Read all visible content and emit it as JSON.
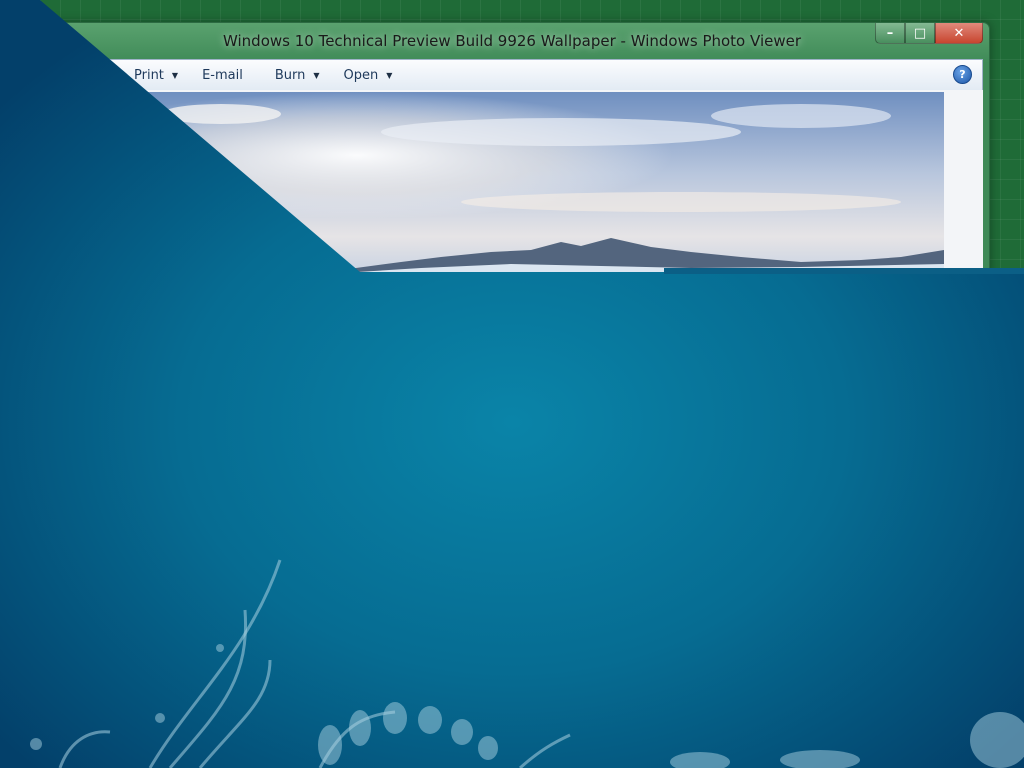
{
  "window": {
    "title": "Windows 10 Technical Preview Build 9926 Wallpaper - Windows Photo Viewer",
    "controls": {
      "minimize": "–",
      "maximize": "□",
      "close": "✕"
    }
  },
  "toolbar": {
    "items": [
      {
        "label": "Print",
        "has_dropdown": true
      },
      {
        "label": "E-mail",
        "has_dropdown": false
      },
      {
        "label": "Burn",
        "has_dropdown": true
      },
      {
        "label": "Open",
        "has_dropdown": true
      }
    ],
    "dropdown_glyph": "▼",
    "help_glyph": "?"
  },
  "icons": {
    "help": "help-icon",
    "dropdown": "chevron-down-icon",
    "minimize": "minimize-icon",
    "maximize": "maximize-icon",
    "close": "close-icon"
  },
  "colors": {
    "desktop_green": "#1f6b37",
    "wallpaper_teal": "#066c92",
    "wallpaper_dark": "#03406a",
    "toolbar_text": "#1e395b",
    "close_button": "#c8452f"
  }
}
